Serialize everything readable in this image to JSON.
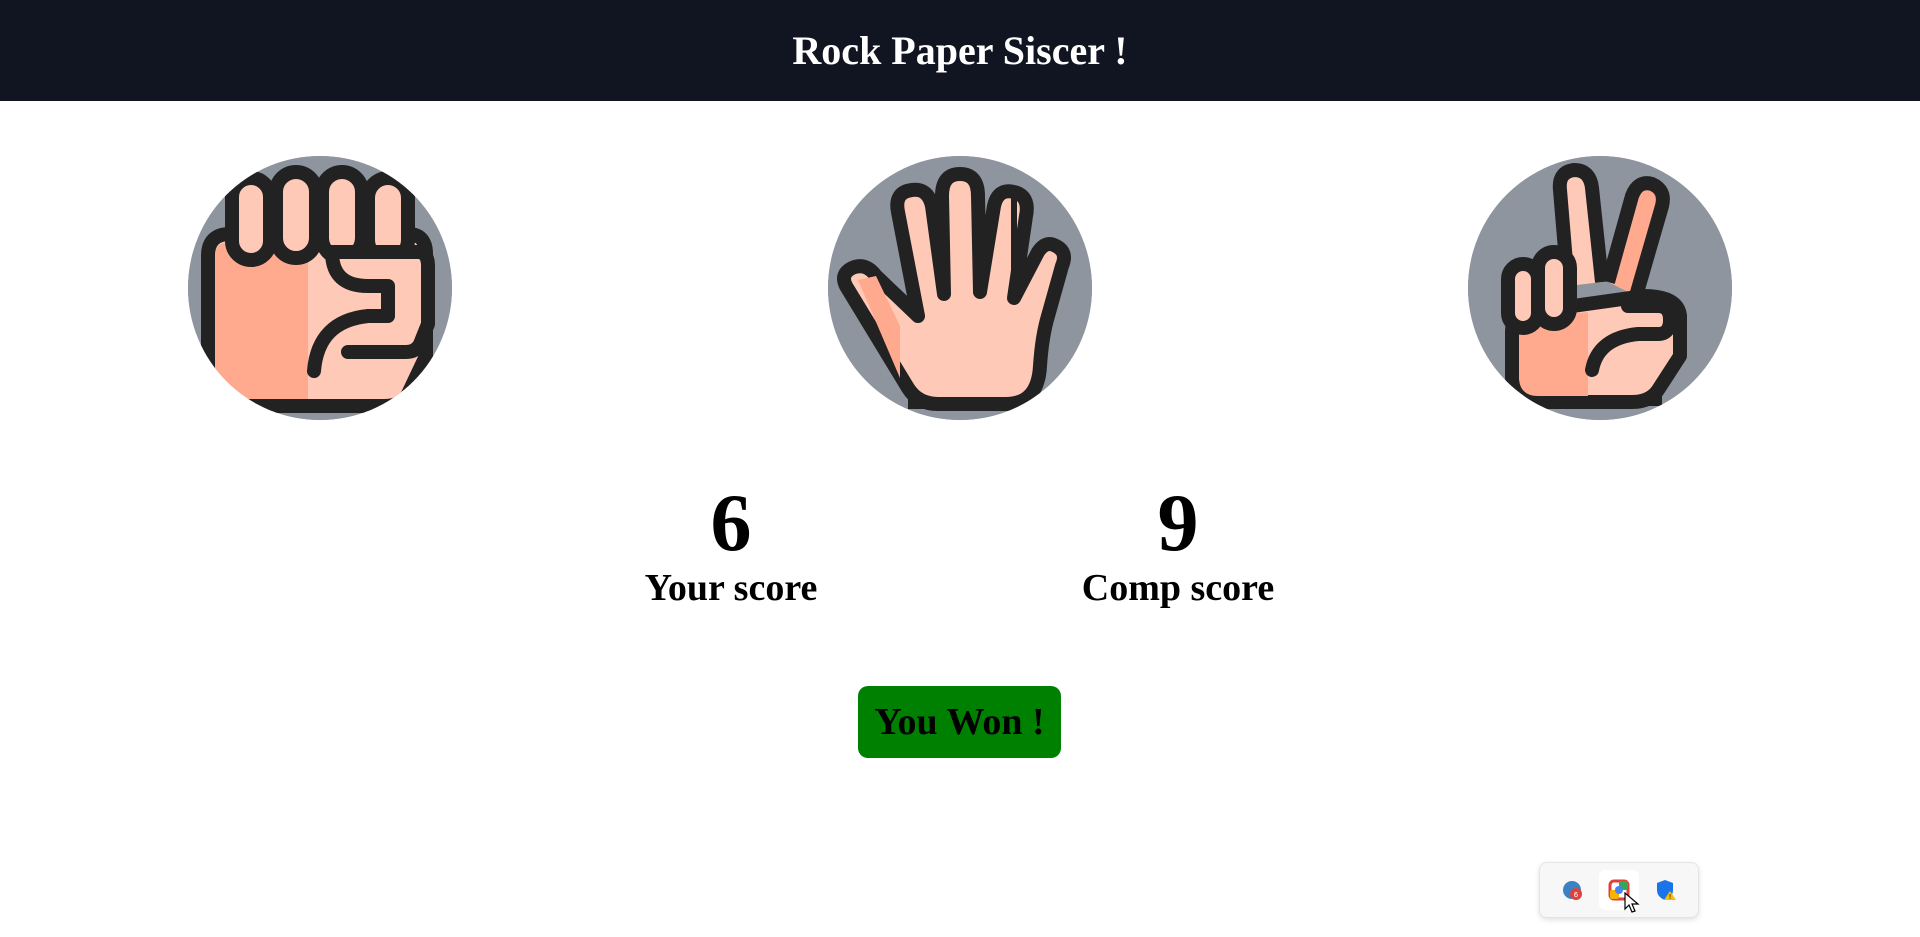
{
  "header": {
    "title": "Rock Paper Siscer !"
  },
  "choices": [
    {
      "id": "rock",
      "icon": "fist-icon"
    },
    {
      "id": "paper",
      "icon": "open-hand-icon"
    },
    {
      "id": "scissors",
      "icon": "victory-hand-icon"
    }
  ],
  "scores": {
    "user": {
      "value": "6",
      "label": "Your score"
    },
    "comp": {
      "value": "9",
      "label": "Comp score"
    }
  },
  "message": {
    "text": "You Won !",
    "color": "#008000"
  },
  "colors": {
    "header_bg": "#111521",
    "circle_bg": "#8e959e",
    "skin_light": "#ffc9b7",
    "skin_dark": "#ffaa8e",
    "outline": "#222222"
  },
  "tray": {
    "items": [
      {
        "icon": "browser-notification-icon"
      },
      {
        "icon": "color-picker-icon"
      },
      {
        "icon": "security-warning-icon"
      }
    ]
  }
}
